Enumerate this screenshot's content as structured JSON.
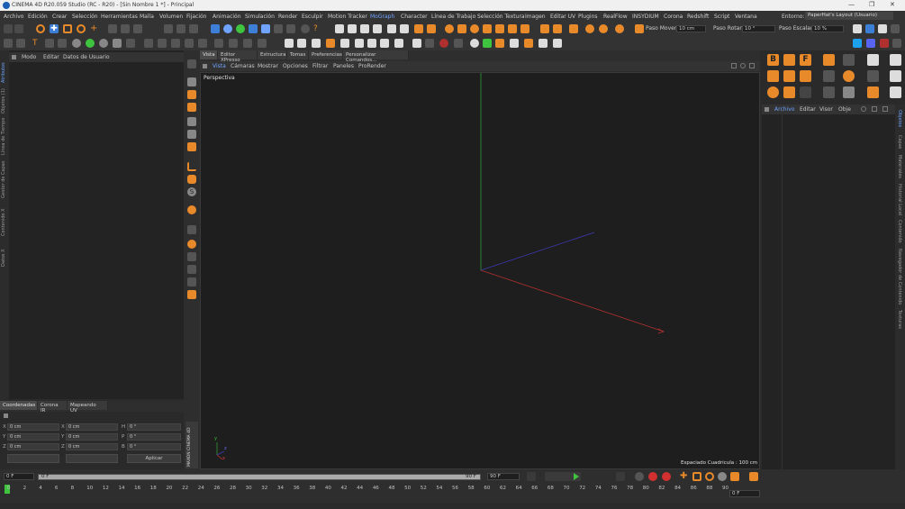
{
  "window": {
    "title": "CINEMA 4D R20.059 Studio (RC - R20) - [Sin Nombre 1 *] - Principal",
    "controls": [
      "—",
      "❐",
      "✕"
    ]
  },
  "menubar": {
    "items": [
      "Archivo",
      "Edición",
      "Crear",
      "Selección",
      "Herramientas",
      "Malla",
      "Volumen",
      "Fijación",
      "Animación",
      "Simulación",
      "Render",
      "Esculpir",
      "Motion Tracker",
      "MoGraph",
      "Character",
      "Línea de Trabajo",
      "Selección Textura",
      "Imagen",
      "Editar UV",
      "Plugins",
      "RealFlow",
      "INSYDIUM",
      "Corona",
      "Redshift",
      "Script",
      "Ventana"
    ],
    "environment_label": "Entorno:",
    "environment_value": "PaperHat's Layout (Usuario)"
  },
  "toolbar": {
    "paso_mover_label": "Paso Mover",
    "paso_mover_value": "10 cm",
    "paso_rotar_label": "Paso Rotar",
    "paso_rotar_value": "10 °",
    "paso_escalar_label": "Paso Escalar",
    "paso_escalar_value": "10 %"
  },
  "left_panel": {
    "menu": [
      "Modo",
      "Editar",
      "Datos de Usuario"
    ],
    "vertical_tabs": [
      "Atributos",
      "Objetos (1)",
      "Línea de Tiempo",
      "Gestor de Capas",
      "Contenido X",
      "Datos X"
    ]
  },
  "viewport_panel": {
    "tabs": [
      "Vista",
      "Editor XPresso",
      "Estructura",
      "Tomas",
      "Preferencias",
      "Personalizar Comandos..."
    ],
    "menu": [
      "Vista",
      "Cámaras",
      "Mostrar",
      "Opciones",
      "Filtrar",
      "Paneles",
      "ProRender"
    ],
    "viewport_name": "Perspectiva",
    "grid_spacing": "Espaciado Cuadrícula : 100 cm",
    "axis_labels": [
      "y",
      "z",
      "x"
    ]
  },
  "right_panel": {
    "menu": [
      "Archivo",
      "Editar",
      "Visor",
      "Obje"
    ],
    "vertical_tabs": [
      "Objetos",
      "Capas",
      "Materiales",
      "Historial Local",
      "Contenido",
      "Navegador de Contenido",
      "Texturas"
    ],
    "brand_letters": [
      "B",
      "F"
    ]
  },
  "coordinates": {
    "tabs": [
      "Coordenadas",
      "Corona IR",
      "Mapeando UV"
    ],
    "rows": [
      {
        "a": "X",
        "av": "0 cm",
        "b": "X",
        "bv": "0 cm",
        "c": "H",
        "cv": "0 °"
      },
      {
        "a": "Y",
        "av": "0 cm",
        "b": "Y",
        "bv": "0 cm",
        "c": "P",
        "cv": "0 °"
      },
      {
        "a": "Z",
        "av": "0 cm",
        "b": "Z",
        "bv": "0 cm",
        "c": "B",
        "cv": "0 °"
      }
    ],
    "apply_label": "Aplicar",
    "side_logo": "MAXON CINEMA 4D"
  },
  "timeline": {
    "start_frame": "0 F",
    "current_frame": "0 F",
    "end_frame": "90 F",
    "end_frame_2": "90 F",
    "right_frame": "0 F",
    "ticks": [
      "0",
      "2",
      "4",
      "6",
      "8",
      "10",
      "12",
      "14",
      "16",
      "18",
      "20",
      "22",
      "24",
      "26",
      "28",
      "30",
      "32",
      "34",
      "36",
      "38",
      "40",
      "42",
      "44",
      "46",
      "48",
      "50",
      "52",
      "54",
      "56",
      "58",
      "60",
      "62",
      "64",
      "66",
      "68",
      "70",
      "72",
      "74",
      "76",
      "78",
      "80",
      "82",
      "84",
      "86",
      "88",
      "90"
    ]
  },
  "colors": {
    "accent_orange": "#e8892a",
    "axis_red": "#b03030",
    "axis_blue": "#3b3bb5",
    "axis_green": "#2f9a3a",
    "highlight_blue": "#3d7fd6",
    "play_green": "#3fc440"
  }
}
